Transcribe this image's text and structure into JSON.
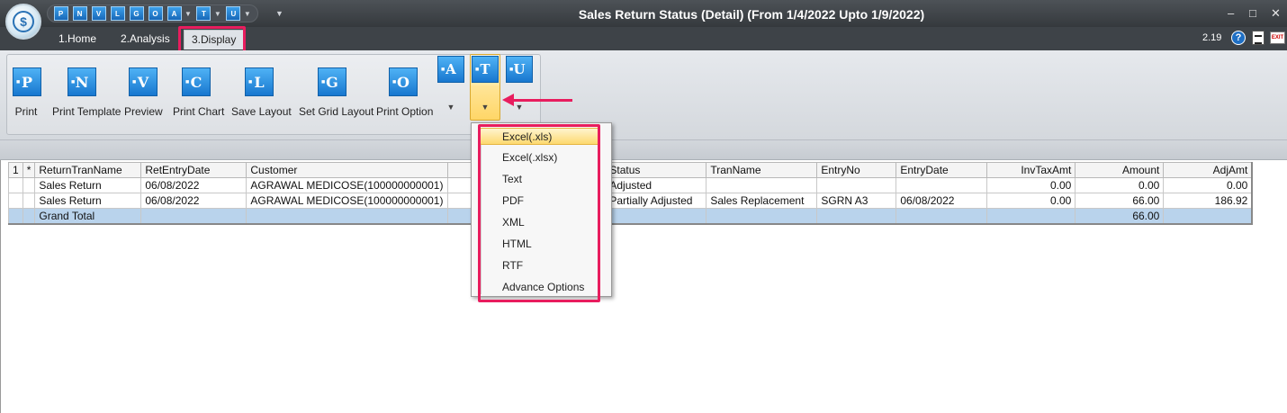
{
  "window": {
    "title": "Sales Return Status (Detail)  (From 1/4/2022 Upto 1/9/2022)",
    "version": "2.19",
    "minimize_icon": "minimize-icon",
    "maximize_icon": "maximize-icon",
    "close_icon": "close-icon"
  },
  "quick_access": {
    "buttons": [
      "P",
      "N",
      "V",
      "L",
      "G",
      "O",
      "A",
      "T",
      "U"
    ]
  },
  "tabs": [
    "1.Home",
    "2.Analysis",
    "3.Display"
  ],
  "active_tab": "3.Display",
  "ribbon": {
    "buttons": [
      {
        "letter": "P",
        "label": "Print"
      },
      {
        "letter": "N",
        "label": "Print Template"
      },
      {
        "letter": "V",
        "label": "Preview"
      },
      {
        "letter": "C",
        "label": "Print Chart"
      },
      {
        "letter": "L",
        "label": "Save Layout"
      },
      {
        "letter": "G",
        "label": "Set Grid Layout"
      },
      {
        "letter": "O",
        "label": "Print Option"
      }
    ],
    "split_buttons": [
      "A",
      "T",
      "U"
    ]
  },
  "export_menu": {
    "items": [
      "Excel(.xls)",
      "Excel(.xlsx)",
      "Text",
      "PDF",
      "XML",
      "HTML",
      "RTF",
      "Advance Options"
    ],
    "selected": "Excel(.xls)"
  },
  "grid": {
    "columns": [
      "1",
      "*",
      "ReturnTranName",
      "RetEntryDate",
      "Customer",
      "",
      "Status",
      "TranName",
      "EntryNo",
      "EntryDate",
      "InvTaxAmt",
      "Amount",
      "AdjAmt"
    ],
    "rows": [
      [
        "",
        "",
        "Sales Return",
        "06/08/2022",
        "AGRAWAL MEDICOSE(100000000001)",
        "",
        "Adjusted",
        "",
        "",
        "",
        "0.00",
        "0.00",
        "0.00"
      ],
      [
        "",
        "",
        "Sales Return",
        "06/08/2022",
        "AGRAWAL MEDICOSE(100000000001)",
        "",
        "Partially Adjusted",
        "Sales Replacement",
        "SGRN A3",
        "06/08/2022",
        "0.00",
        "66.00",
        "186.92"
      ]
    ],
    "total_row": [
      "",
      "",
      "Grand Total",
      "",
      "",
      "",
      "",
      "",
      "",
      "",
      "",
      "66.00",
      ""
    ]
  },
  "colors": {
    "highlight": "#e81d5e",
    "titlebar": "#3e4348",
    "total_row": "#b9d3ec",
    "icon_blue": "#1877cf"
  }
}
